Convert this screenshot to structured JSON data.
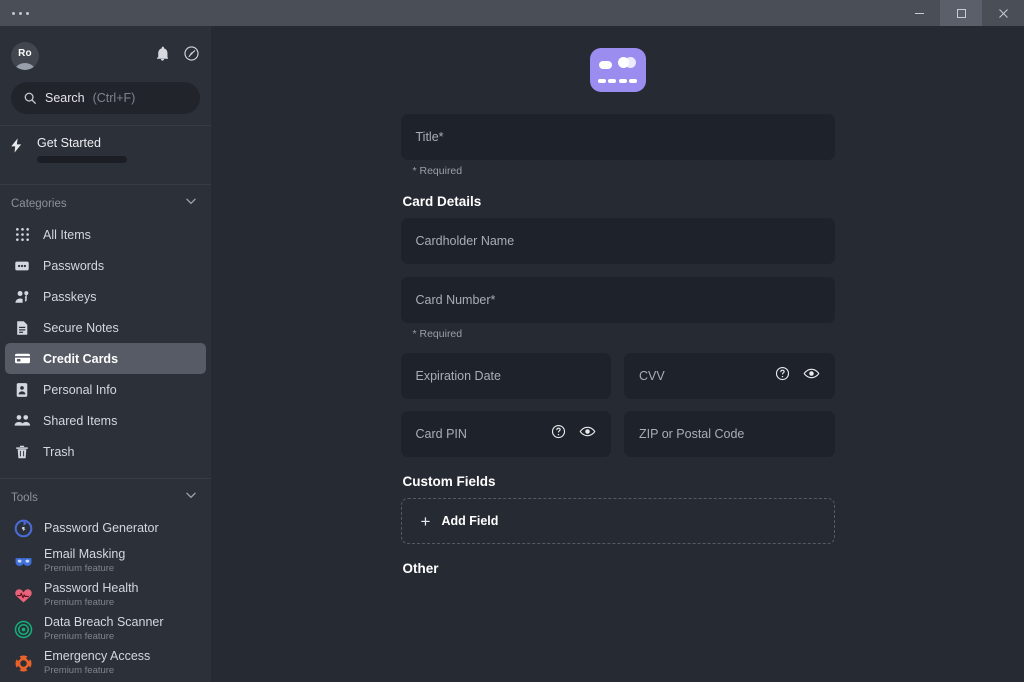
{
  "titlebar": {
    "menu_dots": "•••",
    "minimize_label": "Minimize",
    "maximize_label": "Maximize",
    "close_label": "Close"
  },
  "sidebar": {
    "avatar_initials": "Ro",
    "notifications_label": "Notifications",
    "settings_label": "Settings",
    "search": {
      "placeholder": "Search",
      "shortcut": "(Ctrl+F)"
    },
    "get_started": {
      "label": "Get Started",
      "progress_percent": 0
    },
    "categories": {
      "title": "Categories",
      "items": [
        {
          "label": "All Items",
          "icon": "grid-icon",
          "selected": false
        },
        {
          "label": "Passwords",
          "icon": "password-icon",
          "selected": false
        },
        {
          "label": "Passkeys",
          "icon": "passkey-icon",
          "selected": false
        },
        {
          "label": "Secure Notes",
          "icon": "note-icon",
          "selected": false
        },
        {
          "label": "Credit Cards",
          "icon": "credit-card-icon",
          "selected": true
        },
        {
          "label": "Personal Info",
          "icon": "id-card-icon",
          "selected": false
        },
        {
          "label": "Shared Items",
          "icon": "people-icon",
          "selected": false
        },
        {
          "label": "Trash",
          "icon": "trash-icon",
          "selected": false
        }
      ]
    },
    "tools": {
      "title": "Tools",
      "premium_label": "Premium feature",
      "items": [
        {
          "label": "Password Generator",
          "icon": "refresh-circle-icon",
          "premium": "",
          "color": "#4a6ad4"
        },
        {
          "label": "Email Masking",
          "icon": "mask-icon",
          "premium": "Premium feature",
          "color": "#3f6fd8"
        },
        {
          "label": "Password Health",
          "icon": "heart-pulse-icon",
          "premium": "Premium feature",
          "color": "#e8627a"
        },
        {
          "label": "Data Breach Scanner",
          "icon": "scanner-icon",
          "premium": "Premium feature",
          "color": "#12b07a"
        },
        {
          "label": "Emergency Access",
          "icon": "lifebuoy-icon",
          "premium": "Premium feature",
          "color": "#e8622a"
        }
      ]
    }
  },
  "main": {
    "item_icon": "credit-card-large-icon",
    "title_field": {
      "placeholder": "Title*",
      "required_note": "* Required"
    },
    "card_details": {
      "heading": "Card Details",
      "cardholder_placeholder": "Cardholder Name",
      "card_number_placeholder": "Card Number*",
      "card_number_required_note": "* Required",
      "expiration_placeholder": "Expiration Date",
      "cvv_placeholder": "CVV",
      "card_pin_placeholder": "Card PIN",
      "zip_placeholder": "ZIP or Postal Code",
      "help_icon": "question-circle-icon",
      "reveal_icon": "eye-icon"
    },
    "custom_fields": {
      "heading": "Custom Fields",
      "add_field_label": "Add Field",
      "add_icon": "plus-icon"
    },
    "other": {
      "heading": "Other"
    }
  },
  "colors": {
    "titlebar_bg": "#4a4e57",
    "sidebar_bg": "#2c3038",
    "main_bg": "#262a32",
    "field_bg": "#1e222a",
    "selected_nav_bg": "#565b66",
    "accent_purple": "#9b8cf0"
  }
}
